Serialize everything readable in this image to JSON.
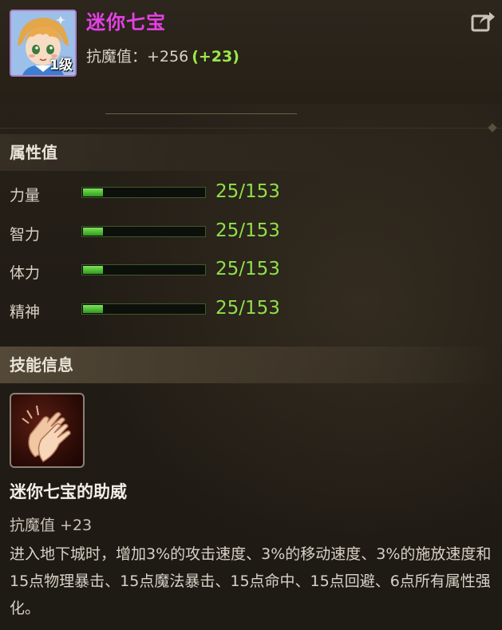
{
  "item": {
    "name": "迷你七宝",
    "level_badge": "1级",
    "stat_label": "抗魔值：",
    "stat_value": "+256",
    "stat_bonus": "(+23)"
  },
  "sections": {
    "attributes_title": "属性值",
    "skills_title": "技能信息"
  },
  "attributes": [
    {
      "name": "力量",
      "value": "25/153",
      "progress": 0.163
    },
    {
      "name": "智力",
      "value": "25/153",
      "progress": 0.163
    },
    {
      "name": "体力",
      "value": "25/153",
      "progress": 0.163
    },
    {
      "name": "精神",
      "value": "25/153",
      "progress": 0.163
    }
  ],
  "skill": {
    "icon": "clapping-hands-icon",
    "name": "迷你七宝的助威",
    "stat": "抗魔值 +23",
    "description": "进入地下城时，增加3%的攻击速度、3%的移动速度、3%的施放速度和15点物理暴击、15点魔法暴击、15点命中、15点回避、6点所有属性强化。"
  },
  "icons": {
    "share": "share-icon",
    "avatar": "character-portrait"
  },
  "colors": {
    "title": "#e640e6",
    "bonus": "#9be84a",
    "bar_value": "#8fe04a"
  }
}
